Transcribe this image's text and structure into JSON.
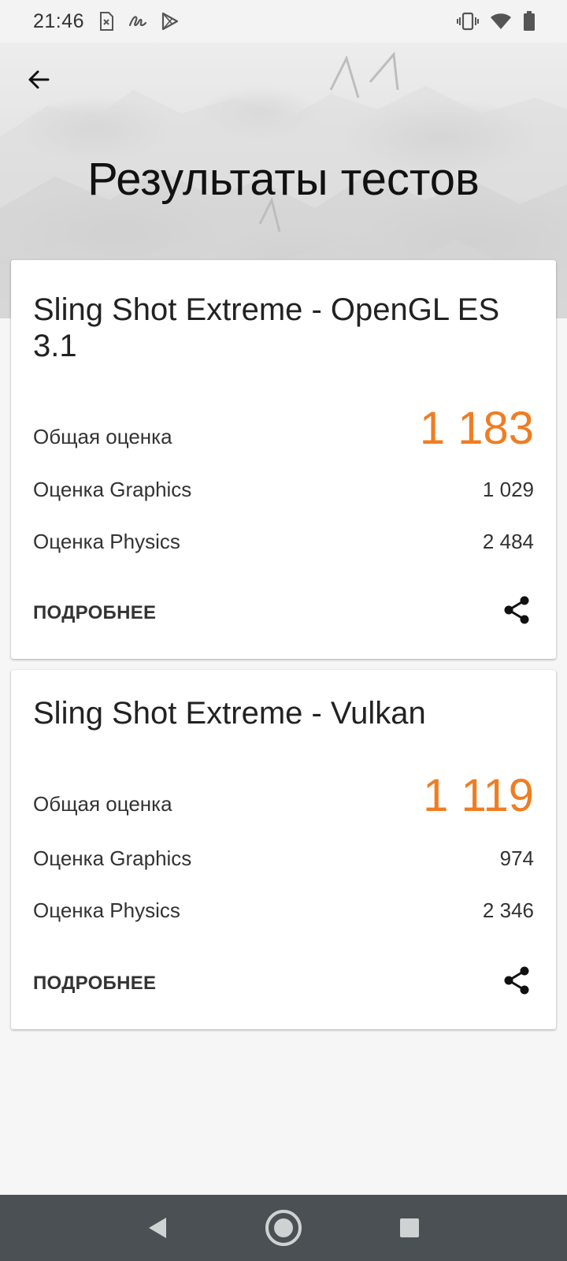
{
  "status_bar": {
    "time": "21:46",
    "left_icons": [
      "sim-error-icon",
      "signature-icon",
      "play-store-icon"
    ],
    "right_icons": [
      "vibrate-icon",
      "wifi-icon",
      "battery-icon"
    ]
  },
  "header": {
    "title": "Результаты тестов",
    "back_icon": "back-arrow-icon"
  },
  "results": [
    {
      "title": "Sling Shot Extreme - OpenGL ES 3.1",
      "overall_label": "Общая оценка",
      "overall_value": "1 183",
      "graphics_label": "Оценка Graphics",
      "graphics_value": "1 029",
      "physics_label": "Оценка Physics",
      "physics_value": "2 484",
      "more_label": "ПОДРОБНЕЕ",
      "share_icon": "share-icon"
    },
    {
      "title": "Sling Shot Extreme - Vulkan",
      "overall_label": "Общая оценка",
      "overall_value": "1 119",
      "graphics_label": "Оценка Graphics",
      "graphics_value": "974",
      "physics_label": "Оценка Physics",
      "physics_value": "2 346",
      "more_label": "ПОДРОБНЕЕ",
      "share_icon": "share-icon"
    }
  ],
  "nav_bar": {
    "buttons": [
      "back-triangle-icon",
      "home-circle-icon",
      "recents-square-icon"
    ]
  },
  "colors": {
    "accent": "#ef7d22",
    "nav_bar": "#4a5053",
    "background": "#f6f6f6"
  }
}
